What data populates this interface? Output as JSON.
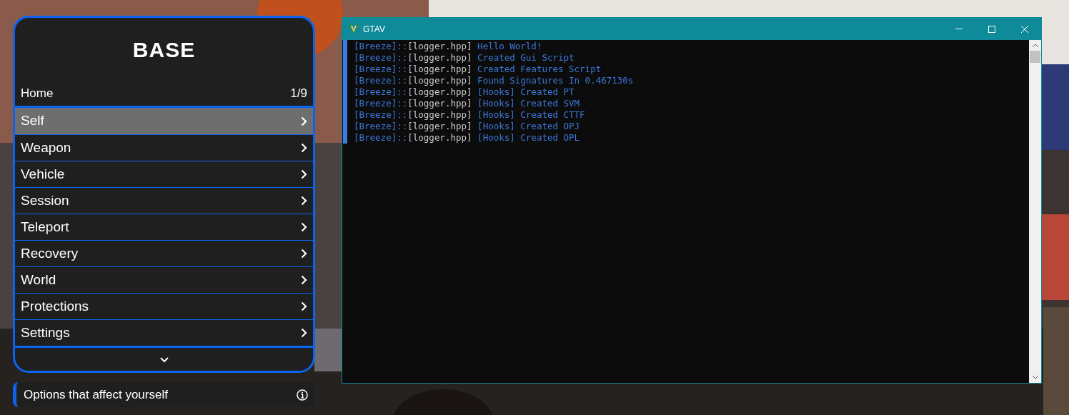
{
  "menu": {
    "title": "BASE",
    "breadcrumb": "Home",
    "page": "1/9",
    "items": [
      {
        "label": "Self",
        "selected": true
      },
      {
        "label": "Weapon",
        "selected": false
      },
      {
        "label": "Vehicle",
        "selected": false
      },
      {
        "label": "Session",
        "selected": false
      },
      {
        "label": "Teleport",
        "selected": false
      },
      {
        "label": "Recovery",
        "selected": false
      },
      {
        "label": "World",
        "selected": false
      },
      {
        "label": "Protections",
        "selected": false
      },
      {
        "label": "Settings",
        "selected": false
      }
    ],
    "description": "Options that affect yourself"
  },
  "console": {
    "title": "GTAV",
    "lines": [
      {
        "source": "[Breeze]::",
        "file": "[logger.hpp]",
        "message": "Hello World!"
      },
      {
        "source": "[Breeze]::",
        "file": "[logger.hpp]",
        "message": "Created Gui Script"
      },
      {
        "source": "[Breeze]::",
        "file": "[logger.hpp]",
        "message": "Created Features Script"
      },
      {
        "source": "[Breeze]::",
        "file": "[logger.hpp]",
        "message": "Found Signatures In 0.467130s"
      },
      {
        "source": "[Breeze]::",
        "file": "[logger.hpp]",
        "message": "[Hooks] Created PT"
      },
      {
        "source": "[Breeze]::",
        "file": "[logger.hpp]",
        "message": "[Hooks] Created SVM"
      },
      {
        "source": "[Breeze]::",
        "file": "[logger.hpp]",
        "message": "[Hooks] Created CTTF"
      },
      {
        "source": "[Breeze]::",
        "file": "[logger.hpp]",
        "message": "[Hooks] Created OPJ"
      },
      {
        "source": "[Breeze]::",
        "file": "[logger.hpp]",
        "message": "[Hooks] Created OPL"
      }
    ]
  }
}
